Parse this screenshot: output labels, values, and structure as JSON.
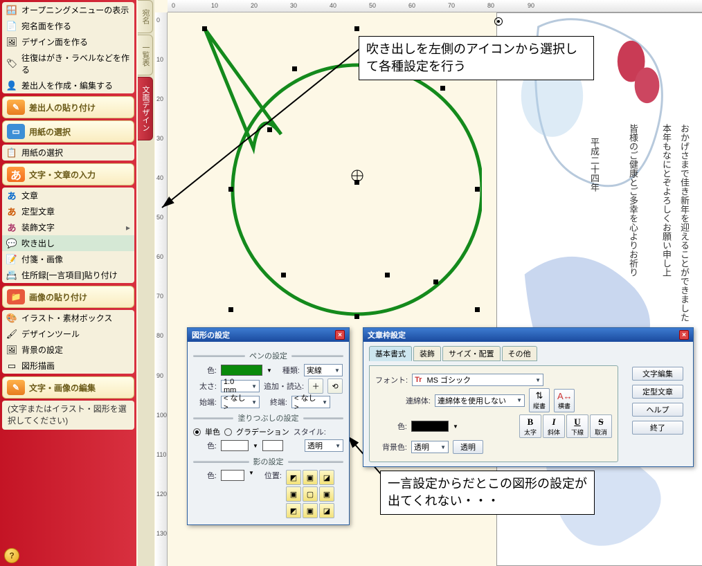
{
  "sidebar": {
    "top_items": [
      {
        "label": "オープニングメニューの表示",
        "icon": "🗔",
        "color": "#d55"
      },
      {
        "label": "宛名面を作る",
        "icon": "📄",
        "color": "#39c"
      },
      {
        "label": "デザイン面を作る",
        "icon": "🎨",
        "color": "#39c"
      },
      {
        "label": "往復はがき・ラベルなどを作る",
        "icon": "🏷",
        "color": "#3a6"
      },
      {
        "label": "差出人を作成・編集する",
        "icon": "👤",
        "color": "#d33"
      }
    ],
    "sec_sender": {
      "title": "差出人の貼り付け"
    },
    "sec_paper": {
      "title": "用紙の選択",
      "items": [
        {
          "label": "用紙の選択",
          "icon": "📋"
        }
      ]
    },
    "sec_text": {
      "title": "文字・文章の入力",
      "items": [
        {
          "label": "文章",
          "icon": "あ"
        },
        {
          "label": "定型文章",
          "icon": "あ"
        },
        {
          "label": "装飾文字",
          "icon": "あ",
          "expand": true
        },
        {
          "label": "吹き出し",
          "icon": "💬",
          "hl": true
        },
        {
          "label": "付箋・画像",
          "icon": "📎"
        },
        {
          "label": "住所録[一言項目]貼り付け",
          "icon": "📇"
        }
      ]
    },
    "sec_image": {
      "title": "画像の貼り付け",
      "items": [
        {
          "label": "イラスト・素材ボックス",
          "icon": "🎨"
        },
        {
          "label": "デザインツール",
          "icon": "🖌"
        },
        {
          "label": "背景の設定",
          "icon": "🖼"
        },
        {
          "label": "図形描画",
          "icon": "◻"
        }
      ]
    },
    "sec_edit": {
      "title": "文字・画像の編集",
      "note": "(文字またはイラスト・図形を選択してください)"
    }
  },
  "vtabs": {
    "addr": "宛名",
    "list": "一覧表",
    "design": "文面デザイン"
  },
  "ruler_h": [
    "0",
    "10",
    "20",
    "30",
    "40",
    "50",
    "60",
    "70",
    "80",
    "90"
  ],
  "ruler_v": [
    "0",
    "10",
    "20",
    "30",
    "40",
    "50",
    "60",
    "70",
    "80",
    "90",
    "100",
    "110",
    "120",
    "130"
  ],
  "callout1": "吹き出しを左側のアイコンから選択して各種設定を行う",
  "callout2": "一言設定からだとこの図形の設定が出てくれない・・・",
  "dlg_shape": {
    "title": "図形の設定",
    "grp_pen": "ペンの設定",
    "color": "色:",
    "kind": "種類:",
    "kind_val": "実線",
    "thick": "太さ:",
    "thick_val": "1.0 mm",
    "addread": "追加・読込:",
    "start": "始端:",
    "none": "< なし >",
    "end": "終端:",
    "grp_fill": "塗りつぶしの設定",
    "mono": "単色",
    "grad": "グラデーション",
    "style": "スタイル:",
    "transp": "透明",
    "grp_shadow": "影の設定",
    "pos": "位置:"
  },
  "dlg_text": {
    "title": "文章枠設定",
    "tabs": [
      "基本書式",
      "装飾",
      "サイズ・配置",
      "その他"
    ],
    "font": "フォント:",
    "font_val": "MS ゴシック",
    "lig": "連綿体:",
    "lig_val": "連綿体を使用しない",
    "color": "色:",
    "bg": "背景色:",
    "transp": "透明",
    "fmt": {
      "b": "太字",
      "i": "斜体",
      "u": "下線",
      "s": "取消"
    },
    "vbtn": "縦書",
    "hbtn": "横書",
    "side": [
      "文字編集",
      "定型文章",
      "ヘルプ",
      "終了"
    ]
  },
  "paper_text": {
    "a": "おかげさまで佳き新年を迎えることができました",
    "b": "本年もなにとぞよろしくお願い申し上",
    "c": "皆様のご健康とご多幸を心よりお祈り",
    "d": "平成二十四年"
  }
}
